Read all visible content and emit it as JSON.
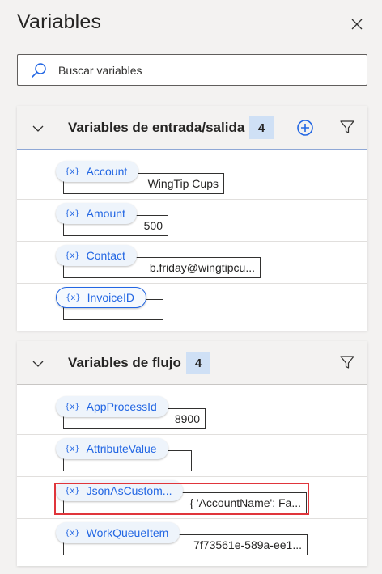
{
  "pane": {
    "title": "Variables"
  },
  "search": {
    "placeholder": "Buscar variables"
  },
  "io_section": {
    "title": "Variables de entrada/salida",
    "count": "4",
    "items": [
      {
        "name": "Account",
        "value": "WingTip Cups"
      },
      {
        "name": "Amount",
        "value": "500"
      },
      {
        "name": "Contact",
        "value": "b.friday@wingtipcu..."
      },
      {
        "name": "InvoiceID",
        "value": ""
      }
    ]
  },
  "flow_section": {
    "title": "Variables de flujo",
    "count": "4",
    "items": [
      {
        "name": "AppProcessId",
        "value": "8900"
      },
      {
        "name": "AttributeValue",
        "value": ""
      },
      {
        "name": "JsonAsCustom...",
        "value": "{ 'AccountName': Fa..."
      },
      {
        "name": "WorkQueueItem",
        "value": "7f73561e-589a-ee1..."
      }
    ]
  },
  "var_icon_glyph": "{x}",
  "colors": {
    "accent": "#2266e3",
    "highlight": "#e0353b",
    "badge": "#cfe0f5"
  }
}
